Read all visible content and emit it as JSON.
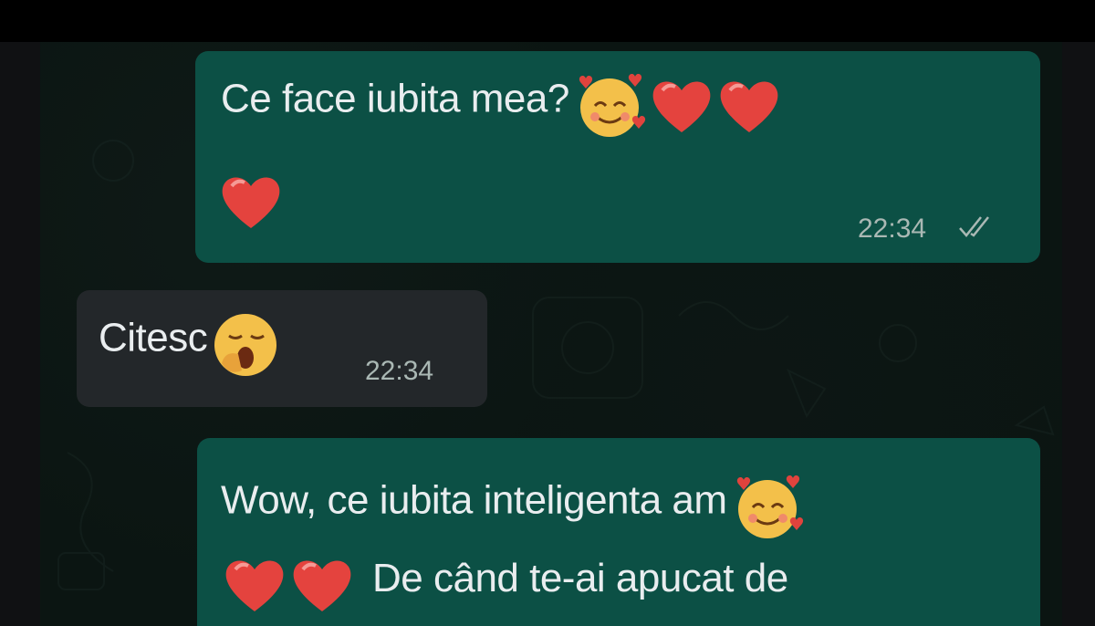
{
  "messages": [
    {
      "direction": "outgoing",
      "text": "Ce face iubita mea?",
      "emojis": [
        "smiling-face-with-hearts",
        "red-heart",
        "red-heart",
        "red-heart"
      ],
      "time": "22:34",
      "status_icon": "double-check-icon"
    },
    {
      "direction": "incoming",
      "text": "Citesc",
      "emojis": [
        "yawning-face"
      ],
      "time": "22:34"
    },
    {
      "direction": "outgoing",
      "text": "Wow, ce iubita inteligenta am",
      "emojis_inline": [
        "smiling-face-with-hearts"
      ],
      "emojis_line2": [
        "red-heart",
        "red-heart"
      ],
      "text_line2": "De când te-ai apucat de"
    }
  ],
  "colors": {
    "outgoing_bubble": "#0c5045",
    "incoming_bubble": "#23272a",
    "chat_background": "#0b1512",
    "text": "#e9edef",
    "meta": "#aab8b4"
  }
}
